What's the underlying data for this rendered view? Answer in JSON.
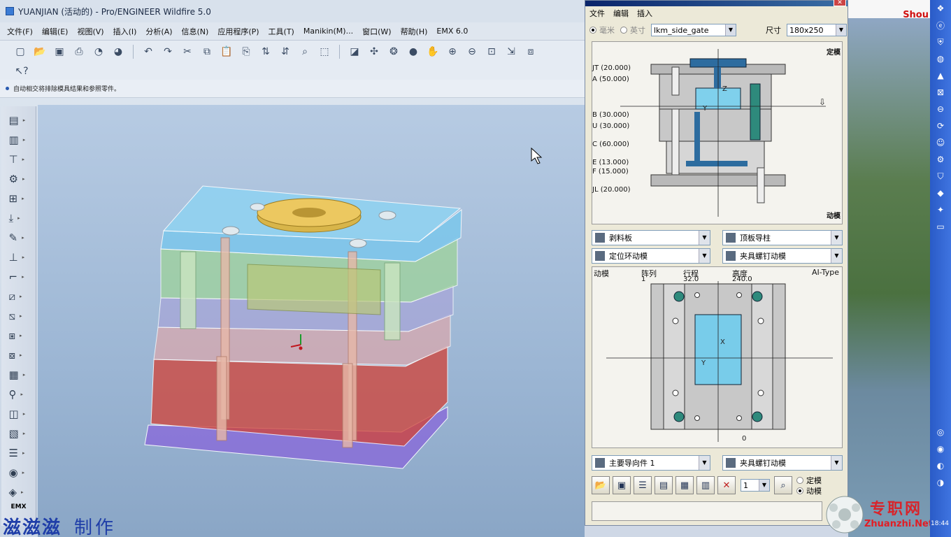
{
  "app": {
    "title": "YUANJIAN (活动的) - Pro/ENGINEER Wildfire 5.0",
    "menu": [
      "文件(F)",
      "编辑(E)",
      "视图(V)",
      "插入(I)",
      "分析(A)",
      "信息(N)",
      "应用程序(P)",
      "工具(T)",
      "Manikin(M)...",
      "窗口(W)",
      "帮助(H)",
      "EMX 6.0"
    ],
    "status_message": "自动相交将排除模具结果和参照零件。",
    "emx_label": "EMX",
    "watermark_main": "滋滋滋",
    "watermark_sub": "制作"
  },
  "dialog": {
    "menu": [
      "文件",
      "编辑",
      "插入"
    ],
    "unit_mm": "毫米",
    "unit_inch": "英寸",
    "library_value": "lkm_side_gate",
    "size_label": "尺寸",
    "size_value": "180x250",
    "top_view": {
      "fixed_label": "定模",
      "moving_label": "动模",
      "plates": [
        "JT (20.000)",
        "A (50.000)",
        "B (30.000)",
        "U (30.000)",
        "C (60.000)",
        "E (13.000)",
        "F (15.000)",
        "JL (20.000)"
      ],
      "axis_z": "Z",
      "axis_y": "Y"
    },
    "combos_mid": [
      {
        "label": "剥料板"
      },
      {
        "label": "顶板导柱"
      },
      {
        "label": "定位环动模"
      },
      {
        "label": "夹具螺钉动模"
      }
    ],
    "plan_view": {
      "side": "动模",
      "col1_header": "阵列",
      "col1_value": "1",
      "col2_header": "行程",
      "col2_value": "32.0",
      "col3_header": "高度",
      "col3_value": "240.0",
      "type": "AI-Type",
      "axis_x": "X",
      "axis_y": "Y",
      "origin": "0"
    },
    "combos_bottom": [
      {
        "label": "主要导向件 1"
      },
      {
        "label": "夹具螺钉动模"
      }
    ],
    "count_value": "1",
    "radio_fixed": "定模",
    "radio_moving": "动模"
  },
  "desktop": {
    "shou_text": "Shou",
    "brand_cn": "专职网",
    "brand_en": "Zhuanzhi.Net",
    "clock": "18:44"
  }
}
